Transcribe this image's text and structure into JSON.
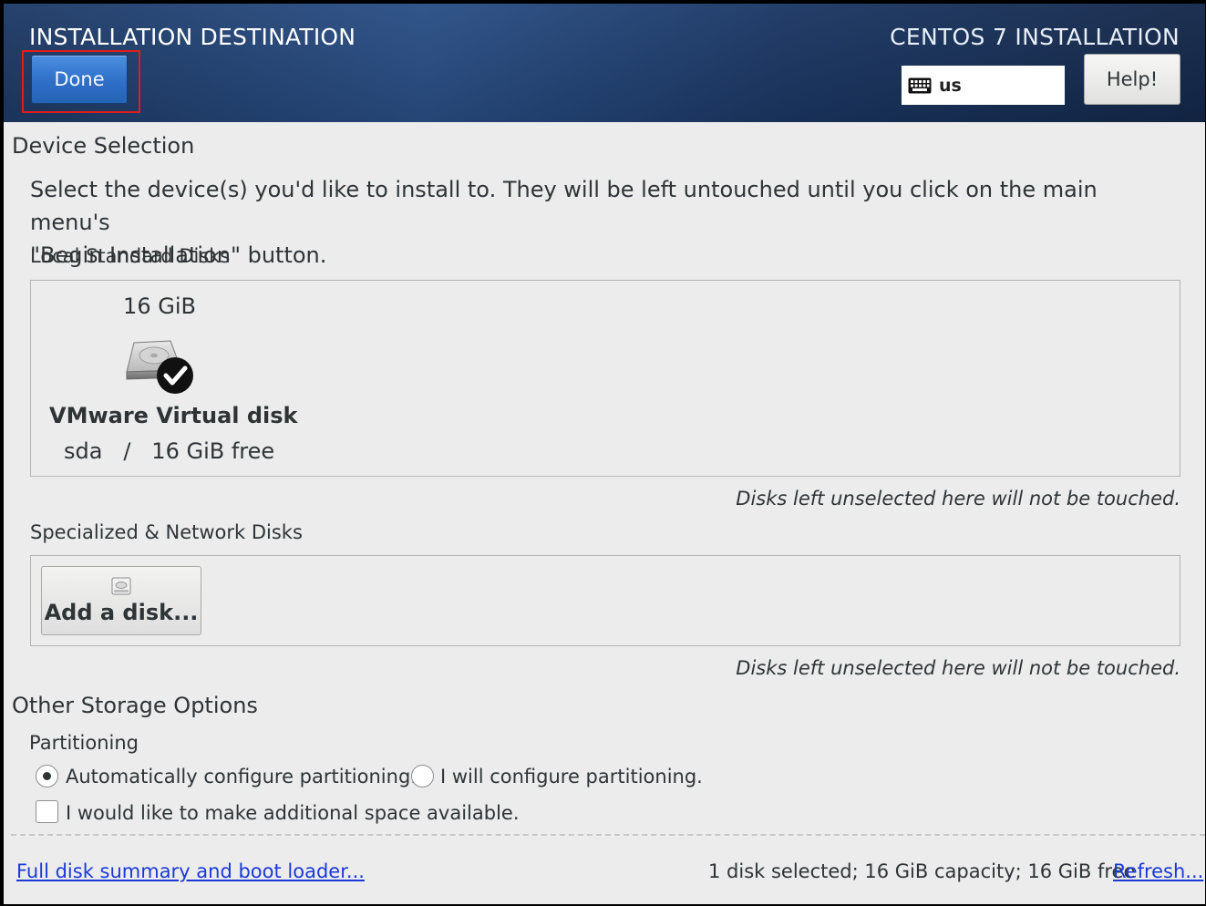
{
  "header": {
    "spoke_title": "INSTALLATION DESTINATION",
    "product_title": "CENTOS 7 INSTALLATION",
    "done_label": "Done",
    "help_label": "Help!",
    "keyboard_layout": "us",
    "keyboard_icon": "keyboard-icon"
  },
  "device_selection": {
    "title": "Device Selection",
    "instructions_line1": "Select the device(s) you'd like to install to.  They will be left untouched until you click on the main menu's",
    "instructions_line2": "\"Begin Installation\" button.",
    "local_label": "Local Standard Disks",
    "disks": [
      {
        "size": "16 GiB",
        "name": "VMware Virtual disk",
        "info": "sda   /   16 GiB free",
        "selected": true,
        "icon": "hard-disk-icon"
      }
    ],
    "local_note": "Disks left unselected here will not be touched.",
    "specialized_label": "Specialized & Network Disks",
    "add_disk_label": "Add a disk...",
    "specialized_note": "Disks left unselected here will not be touched."
  },
  "other_storage": {
    "title": "Other Storage Options",
    "partitioning_label": "Partitioning",
    "auto_partition_label": "Automatically configure partitioning.",
    "manual_partition_label": "I will configure partitioning.",
    "selected_partitioning": "auto",
    "extra_space_label": "I would like to make additional space available.",
    "extra_space_checked": false
  },
  "footer": {
    "summary_link": "Full disk summary and boot loader...",
    "status": "1 disk selected; 16 GiB capacity; 16 GiB free",
    "refresh_link": "Refresh..."
  },
  "colors": {
    "header_bg": "#1e3a66",
    "done_button": "#2f6fc8",
    "highlight_border": "#e21b1b",
    "link": "#1a39d6",
    "body_bg": "#ececec"
  }
}
